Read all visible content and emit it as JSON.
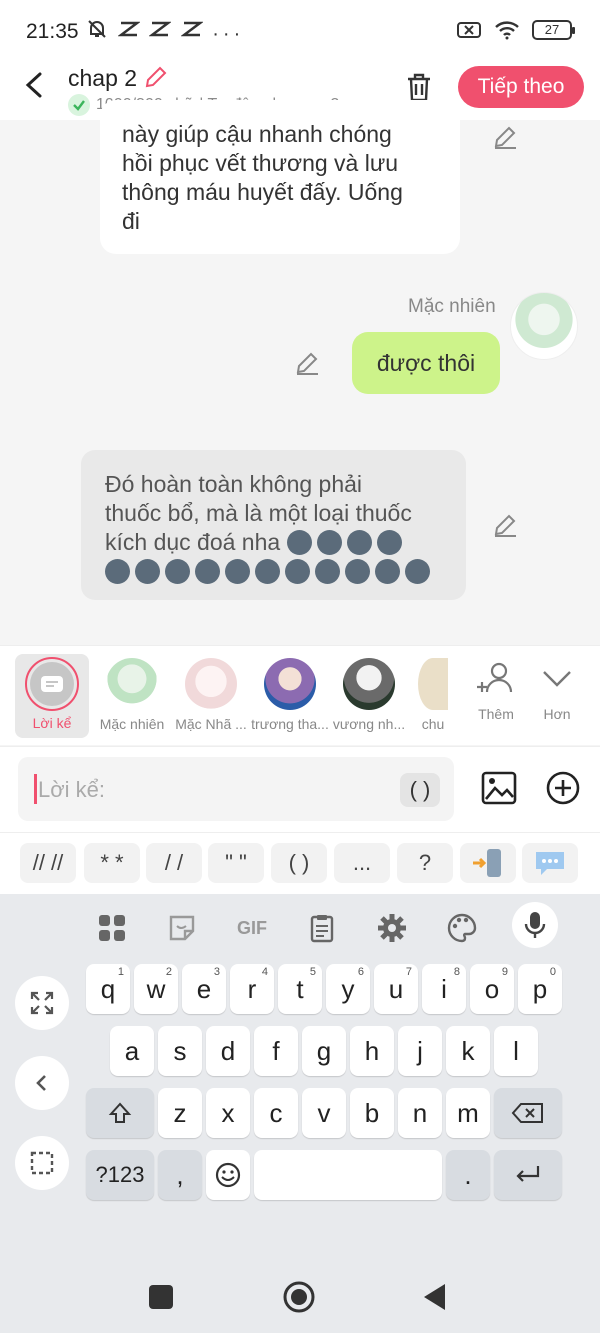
{
  "status_bar": {
    "time": "21:35",
    "battery": "27",
    "more": "···"
  },
  "header": {
    "title": "chap 2",
    "subtitle": "1000/300 chữ | Tự động lưu sau 2",
    "next_button": "Tiếp theo"
  },
  "chat": {
    "message_1_lines": [
      "này giúp cậu nhanh chóng",
      "hồi phục vết thương và lưu",
      "thông máu huyết đấy. Uống",
      "đi"
    ],
    "message_2_sender": "Mặc nhiên",
    "message_2_text": "được thôi",
    "message_3_lines": [
      "Đó hoàn toàn không phải",
      "thuốc bổ, mà là một loại thuốc",
      "kích dục đoá nha"
    ]
  },
  "characters": [
    {
      "label": "Lời kể"
    },
    {
      "label": "Mặc nhiên"
    },
    {
      "label": "Mặc Nhã ..."
    },
    {
      "label": "trương tha..."
    },
    {
      "label": "vương nh..."
    },
    {
      "label": "chu"
    }
  ],
  "char_actions": {
    "add": "Thêm",
    "more": "Hơn"
  },
  "input": {
    "placeholder": "Lời kể:",
    "paren": "( )"
  },
  "format_buttons": [
    "// //",
    "* *",
    "/ /",
    "\" \"",
    "( )",
    "...",
    "?"
  ],
  "keyboard": {
    "row1": [
      {
        "k": "q",
        "n": "1"
      },
      {
        "k": "w",
        "n": "2"
      },
      {
        "k": "e",
        "n": "3"
      },
      {
        "k": "r",
        "n": "4"
      },
      {
        "k": "t",
        "n": "5"
      },
      {
        "k": "y",
        "n": "6"
      },
      {
        "k": "u",
        "n": "7"
      },
      {
        "k": "i",
        "n": "8"
      },
      {
        "k": "o",
        "n": "9"
      },
      {
        "k": "p",
        "n": "0"
      }
    ],
    "row2": [
      "a",
      "s",
      "d",
      "f",
      "g",
      "h",
      "j",
      "k",
      "l"
    ],
    "row3": [
      "z",
      "x",
      "c",
      "v",
      "b",
      "n",
      "m"
    ],
    "num_key": "?123",
    "comma": ",",
    "period": ".",
    "gif": "GIF"
  },
  "colors": {
    "accent": "#f0506e",
    "green_bubble": "#cdf38a"
  },
  "icons": [
    "muted-bell-icon",
    "app-icon",
    "wifi-icon",
    "battery-icon",
    "back-icon",
    "edit-icon",
    "trash-icon",
    "check-icon",
    "image-icon",
    "plus-circle-icon",
    "add-person-icon",
    "chevron-down-icon",
    "grid-icon",
    "sticker-icon",
    "clipboard-icon",
    "gear-icon",
    "palette-icon",
    "mic-icon",
    "expand-icon",
    "chevron-left-icon",
    "select-icon",
    "shift-icon",
    "backspace-icon",
    "emoji-icon",
    "enter-icon",
    "square-icon",
    "circle-icon",
    "triangle-icon"
  ]
}
